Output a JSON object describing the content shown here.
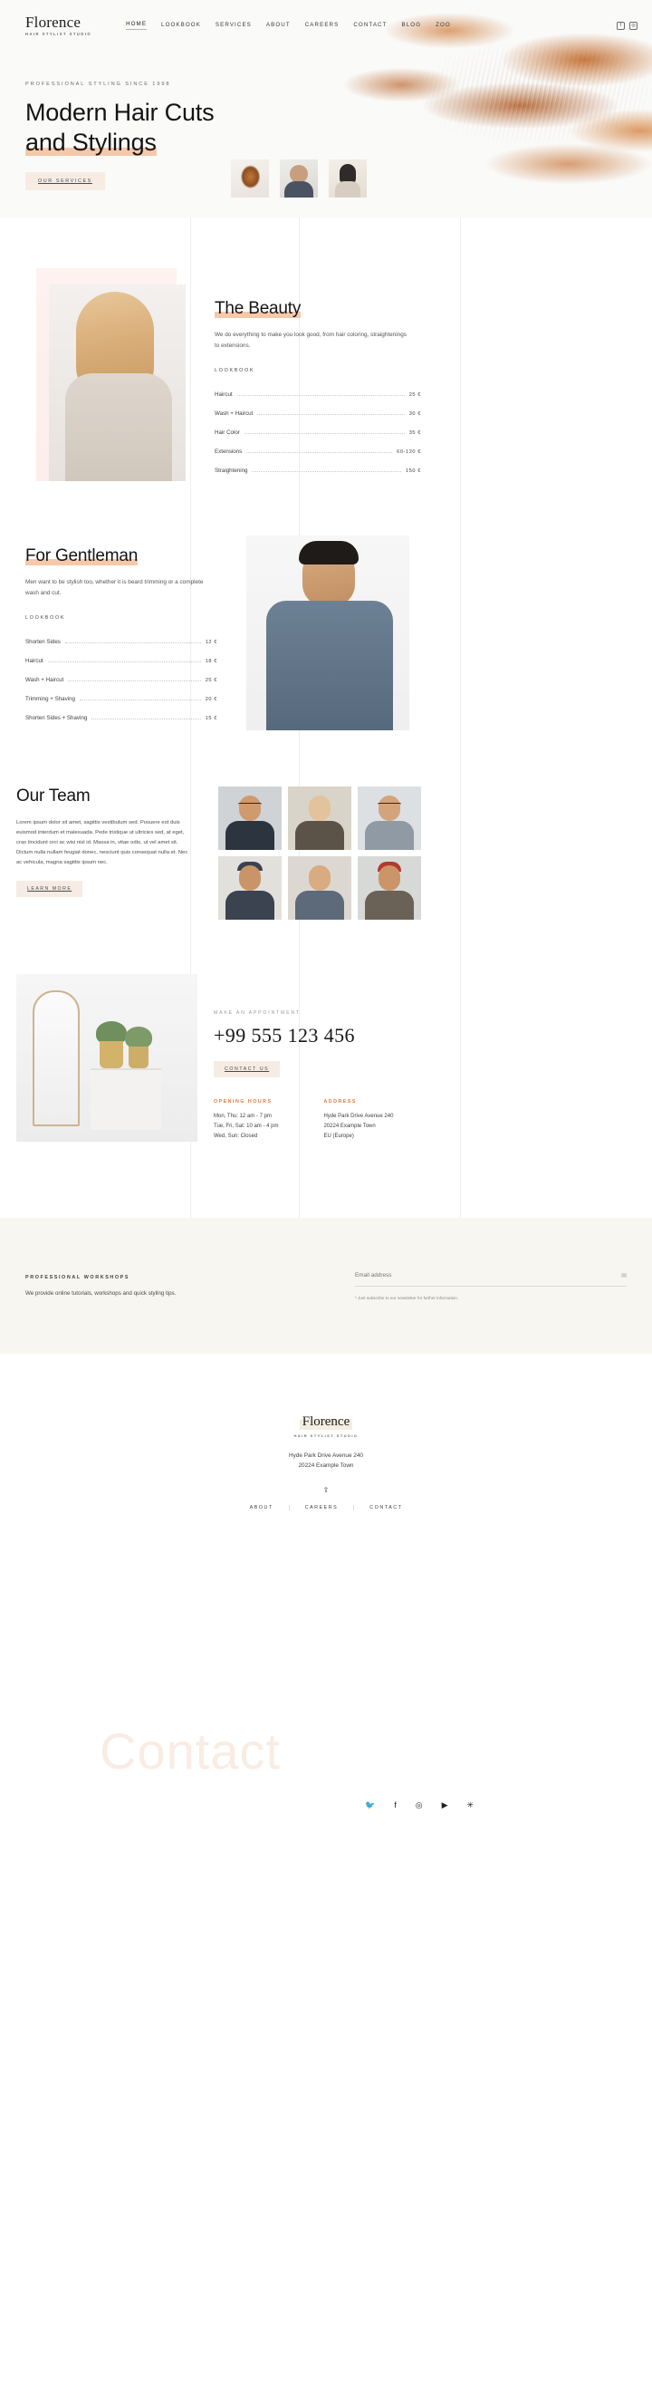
{
  "header": {
    "brand_name": "Florence",
    "brand_tagline": "Hair Stylist Studio",
    "nav": [
      {
        "label": "Home",
        "active": true
      },
      {
        "label": "Lookbook",
        "active": false
      },
      {
        "label": "Services",
        "active": false
      },
      {
        "label": "About",
        "active": false
      },
      {
        "label": "Careers",
        "active": false
      },
      {
        "label": "Contact",
        "active": false
      },
      {
        "label": "Blog",
        "active": false
      },
      {
        "label": "Zoo",
        "active": false
      }
    ],
    "social": [
      {
        "icon": "facebook-icon",
        "glyph": "f"
      },
      {
        "icon": "instagram-icon",
        "glyph": "◎"
      }
    ]
  },
  "hero": {
    "eyebrow": "Professional Styling Since 1998",
    "title_line1": "Modern Hair Cuts",
    "title_line2": "and Stylings",
    "cta": "Our Services"
  },
  "beauty": {
    "title": "The Beauty",
    "lead": "We do everything to make you look good, from hair coloring, straightenings to extensions.",
    "kicker": "Lookbook",
    "prices": [
      {
        "name": "Haircut",
        "value": "25 €"
      },
      {
        "name": "Wash + Haircut",
        "value": "30 €"
      },
      {
        "name": "Hair Color",
        "value": "35 €"
      },
      {
        "name": "Extensions",
        "value": "60-120 €"
      },
      {
        "name": "Straightening",
        "value": "150 €"
      }
    ]
  },
  "gentleman": {
    "title": "For Gentleman",
    "lead": "Men want to be stylish too, whether it is beard trimming or a complete wash and cut.",
    "kicker": "Lookbook",
    "prices": [
      {
        "name": "Shorten Sides",
        "value": "12 €"
      },
      {
        "name": "Haircut",
        "value": "18 €"
      },
      {
        "name": "Wash + Haircut",
        "value": "25 €"
      },
      {
        "name": "Trimming + Shaving",
        "value": "20 €"
      },
      {
        "name": "Shorten Sides + Shaving",
        "value": "15 €"
      }
    ]
  },
  "team": {
    "title": "Our Team",
    "body": "Lorem ipsum dolor sit amet, sagittis vestibulum sed. Posuere est duis euismod interdum et malesuada. Pede tristique ut ultricies sed, at eget, cras tincidunt orci ac wisi nisl id. Massa in, vitae odio, ut vel amet sit. Dictum nulla nullam feugiat donec, nesciunt quis consequat nulla et. Nec ac vehicula, magna sagittis ipsum nec.",
    "cta": "Learn More"
  },
  "contact": {
    "watermark": "Contact",
    "eyebrow": "Make an Appointment",
    "phone": "+99 555 123 456",
    "cta": "Contact Us",
    "hours_title": "Opening Hours",
    "hours": "Mon, Thu: 12 am - 7 pm\nTue, Fri, Sat: 10 am - 4 pm\nWed, Sun: Closed",
    "address_title": "Address",
    "address": "Hyde Park Drive Avenue 240\n20224 Example Town\nEU (Europe)",
    "socials": [
      {
        "icon": "twitter-icon",
        "glyph": "🐦"
      },
      {
        "icon": "facebook-icon",
        "glyph": "f"
      },
      {
        "icon": "instagram-icon",
        "glyph": "◎"
      },
      {
        "icon": "youtube-icon",
        "glyph": "▶"
      },
      {
        "icon": "yelp-icon",
        "glyph": "✳"
      }
    ]
  },
  "newsletter": {
    "kicker": "Professional Workshops",
    "text": "We provide online tutorials, workshops and quick styling tips.",
    "placeholder": "Email address",
    "value": "",
    "note": "* Just subscribe to our newsletter for further information.",
    "submit_icon": "envelope-icon"
  },
  "footer": {
    "brand_name": "Florence",
    "brand_tagline": "Hair Stylist Studio",
    "address_line1": "Hyde Park Drive Avenue 240",
    "address_line2": "20224 Example Town",
    "scroll_top_icon": "arrow-up-icon",
    "nav": [
      {
        "label": "About"
      },
      {
        "label": "Careers"
      },
      {
        "label": "Contact"
      }
    ]
  },
  "colors": {
    "accent_peach": "#f6c8aa",
    "accent_orange": "#e2793f",
    "button_bg": "#f7ece4",
    "newsletter_bg": "#f7f6f0",
    "hero_bg": "#fafaf9"
  }
}
